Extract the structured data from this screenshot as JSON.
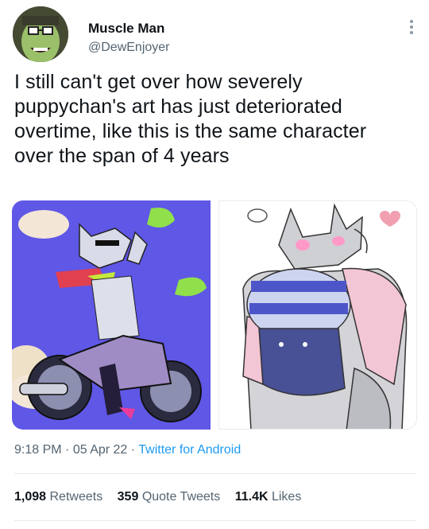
{
  "user": {
    "display_name": "Muscle Man",
    "handle": "@DewEnjoyer"
  },
  "tweet": {
    "lines": [
      "I still can't get over how severely",
      "puppychan's art has just deteriorated",
      "overtime, like this is the same character",
      "over the span of 4 years"
    ]
  },
  "meta": {
    "time": "9:18 PM",
    "date": "05 Apr 22",
    "source": "Twitter for Android",
    "sep": "·"
  },
  "stats": {
    "retweets_count": "1,098",
    "retweets_label": "Retweets",
    "quotes_count": "359",
    "quotes_label": "Quote Tweets",
    "likes_count": "11.4K",
    "likes_label": "Likes"
  },
  "colors": {
    "link": "#1d9bf0",
    "secondary_text": "#536471",
    "left_art_bg": "#5f57e6"
  }
}
